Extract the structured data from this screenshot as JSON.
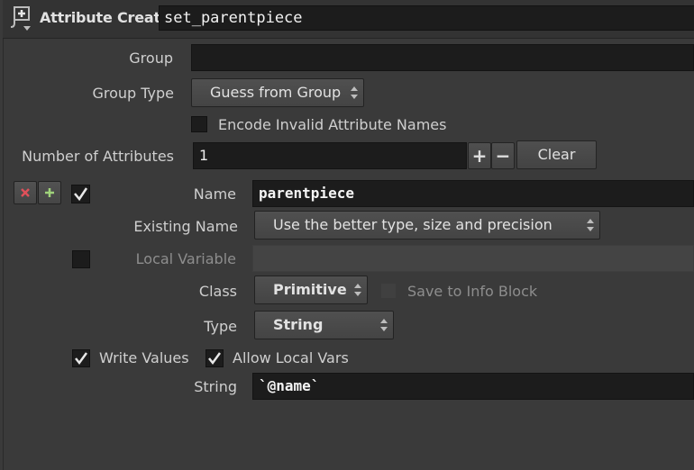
{
  "node": {
    "type_label": "Attribute Create",
    "name": "set_parentpiece"
  },
  "group": {
    "label": "Group",
    "value": ""
  },
  "group_type": {
    "label": "Group Type",
    "value": "Guess from Group"
  },
  "encode_invalid": {
    "label": "Encode Invalid Attribute Names",
    "checked": false
  },
  "num_attributes": {
    "label": "Number of Attributes",
    "value": "1",
    "plus_label": "+",
    "minus_label": "−",
    "clear_label": "Clear"
  },
  "attribute": {
    "enabled": true,
    "name_label": "Name",
    "name_value": "parentpiece",
    "existing_name_label": "Existing Name",
    "existing_name_value": "Use the better type, size and precision",
    "local_variable_label": "Local Variable",
    "local_variable_value": "",
    "local_variable_enabled": false,
    "class_label": "Class",
    "class_value": "Primitive",
    "save_info_label": "Save to Info Block",
    "type_label": "Type",
    "type_value": "String",
    "write_values_label": "Write Values",
    "write_values_checked": true,
    "allow_local_vars_label": "Allow Local Vars",
    "allow_local_vars_checked": true,
    "string_label": "String",
    "string_value": "`@name`"
  },
  "colors": {
    "background": "#3a3a3a",
    "field": "#1c1c1c",
    "text": "#d7d7d7",
    "remove_icon": "#e0505a",
    "add_icon": "#9fd27a"
  },
  "icons": [
    "node-type-icon",
    "remove-multiparm-icon",
    "add-multiparm-icon",
    "checkmark-icon",
    "dropdown-arrows-icon"
  ]
}
